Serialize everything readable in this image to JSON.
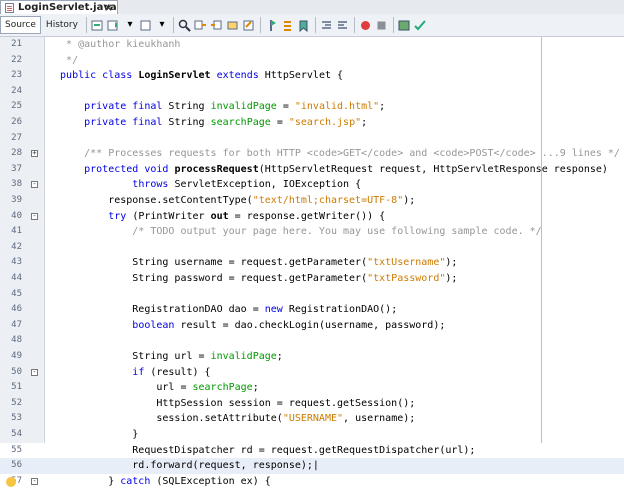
{
  "tab": {
    "title": "LoginServlet.java",
    "close": "×"
  },
  "toolbar": {
    "source_label": "Source",
    "history_label": "History"
  },
  "lines": [
    {
      "n": "21",
      "tokens": [
        {
          "t": "   * @author kieukhanh",
          "c": "c"
        }
      ]
    },
    {
      "n": "22",
      "tokens": [
        {
          "t": "   */",
          "c": "c"
        }
      ]
    },
    {
      "n": "23",
      "tokens": [
        {
          "t": "  public class ",
          "c": "k"
        },
        {
          "t": "LoginServlet ",
          "c": "b"
        },
        {
          "t": "extends ",
          "c": "k"
        },
        {
          "t": "HttpServlet {"
        }
      ]
    },
    {
      "n": "24",
      "tokens": [
        {
          "t": ""
        }
      ]
    },
    {
      "n": "25",
      "tokens": [
        {
          "t": "      "
        },
        {
          "t": "private final ",
          "c": "k"
        },
        {
          "t": "String "
        },
        {
          "t": "invalidPage",
          "c": "f"
        },
        {
          "t": " = "
        },
        {
          "t": "\"invalid.html\"",
          "c": "s"
        },
        {
          "t": ";"
        }
      ]
    },
    {
      "n": "26",
      "tokens": [
        {
          "t": "      "
        },
        {
          "t": "private final ",
          "c": "k"
        },
        {
          "t": "String "
        },
        {
          "t": "searchPage",
          "c": "f"
        },
        {
          "t": " = "
        },
        {
          "t": "\"search.jsp\"",
          "c": "s"
        },
        {
          "t": ";"
        }
      ]
    },
    {
      "n": "27",
      "tokens": [
        {
          "t": ""
        }
      ]
    },
    {
      "n": "28",
      "fold": "+",
      "tokens": [
        {
          "t": "      /** Processes requests for both HTTP <code>GET</code> and <code>POST</code> ...9 lines */",
          "c": "c"
        }
      ]
    },
    {
      "n": "37",
      "tokens": [
        {
          "t": "      "
        },
        {
          "t": "protected void ",
          "c": "k"
        },
        {
          "t": "processRequest",
          "c": "b"
        },
        {
          "t": "(HttpServletRequest request, HttpServletResponse response)"
        }
      ]
    },
    {
      "n": "38",
      "fold": "-",
      "tokens": [
        {
          "t": "              "
        },
        {
          "t": "throws ",
          "c": "k"
        },
        {
          "t": "ServletException, IOException {"
        }
      ]
    },
    {
      "n": "39",
      "tokens": [
        {
          "t": "          response.setContentType("
        },
        {
          "t": "\"text/html;charset=UTF-8\"",
          "c": "s"
        },
        {
          "t": ");"
        }
      ]
    },
    {
      "n": "40",
      "fold": "-",
      "tokens": [
        {
          "t": "          "
        },
        {
          "t": "try ",
          "c": "k"
        },
        {
          "t": "(PrintWriter "
        },
        {
          "t": "out",
          "c": "b"
        },
        {
          "t": " = response.getWriter()) {"
        }
      ]
    },
    {
      "n": "41",
      "tokens": [
        {
          "t": "              /* TODO output your page here. You may use following sample code. */",
          "c": "c"
        }
      ]
    },
    {
      "n": "42",
      "tokens": [
        {
          "t": ""
        }
      ]
    },
    {
      "n": "43",
      "tokens": [
        {
          "t": "              String username = request.getParameter("
        },
        {
          "t": "\"txtUsername\"",
          "c": "s"
        },
        {
          "t": ");"
        }
      ]
    },
    {
      "n": "44",
      "tokens": [
        {
          "t": "              String password = request.getParameter("
        },
        {
          "t": "\"txtPassword\"",
          "c": "s"
        },
        {
          "t": ");"
        }
      ]
    },
    {
      "n": "45",
      "tokens": [
        {
          "t": ""
        }
      ]
    },
    {
      "n": "46",
      "tokens": [
        {
          "t": "              RegistrationDAO dao = "
        },
        {
          "t": "new ",
          "c": "k"
        },
        {
          "t": "RegistrationDAO();"
        }
      ]
    },
    {
      "n": "47",
      "tokens": [
        {
          "t": "              "
        },
        {
          "t": "boolean ",
          "c": "k"
        },
        {
          "t": "result = dao.checkLogin(username, password);"
        }
      ]
    },
    {
      "n": "48",
      "tokens": [
        {
          "t": ""
        }
      ]
    },
    {
      "n": "49",
      "tokens": [
        {
          "t": "              String url = "
        },
        {
          "t": "invalidPage",
          "c": "f"
        },
        {
          "t": ";"
        }
      ]
    },
    {
      "n": "50",
      "fold": "-",
      "tokens": [
        {
          "t": "              "
        },
        {
          "t": "if ",
          "c": "k"
        },
        {
          "t": "(result) {"
        }
      ]
    },
    {
      "n": "51",
      "tokens": [
        {
          "t": "                  url = "
        },
        {
          "t": "searchPage",
          "c": "f"
        },
        {
          "t": ";"
        }
      ]
    },
    {
      "n": "52",
      "tokens": [
        {
          "t": "                  HttpSession session = request.getSession();"
        }
      ]
    },
    {
      "n": "53",
      "tokens": [
        {
          "t": "                  session.setAttribute("
        },
        {
          "t": "\"USERNAME\"",
          "c": "s"
        },
        {
          "t": ", username);"
        }
      ]
    },
    {
      "n": "54",
      "tokens": [
        {
          "t": "              }"
        }
      ]
    },
    {
      "n": "55",
      "tokens": [
        {
          "t": "              RequestDispatcher rd = request.getRequestDispatcher(url);"
        }
      ]
    },
    {
      "n": "56",
      "current": true,
      "tokens": [
        {
          "t": "              rd.forward(request, response);|"
        }
      ]
    },
    {
      "n": "57",
      "warn": true,
      "fold": "-",
      "tokens": [
        {
          "t": "          } "
        },
        {
          "t": "catch ",
          "c": "k"
        },
        {
          "t": "(SQLException ex) {"
        }
      ]
    }
  ]
}
